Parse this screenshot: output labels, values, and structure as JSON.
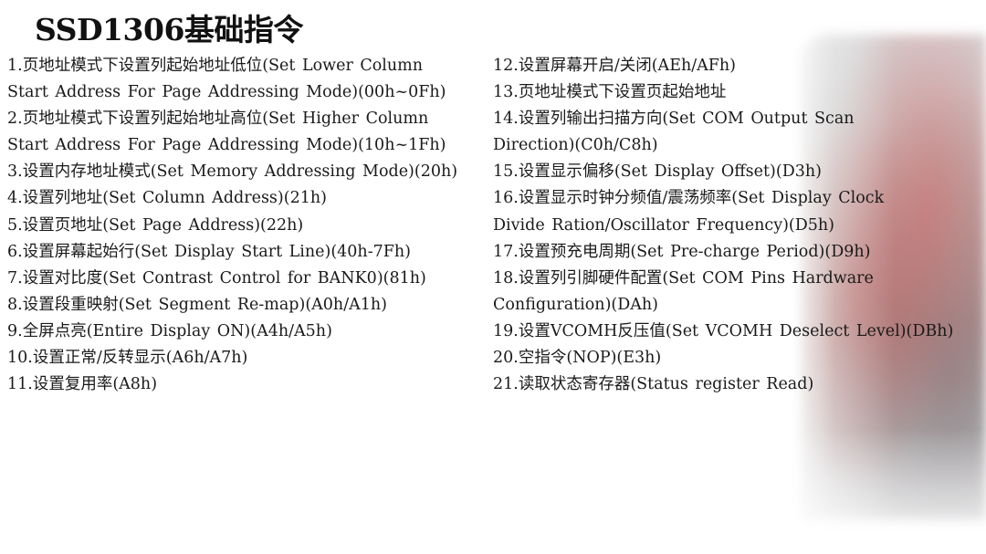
{
  "title": "SSD1306基础指令",
  "left_column": {
    "lines": [
      "1.页地址模式下设置列起始地址低位(Set  Lower Column",
      "Start Address For Page Addressing Mode)(00h~0Fh)",
      "2.页地址模式下设置列起始地址高位(Set  Higher Column",
      "Start Address For Page Addressing Mode)(10h~1Fh)",
      "3.设置内存地址模式(Set Memory Addressing Mode)(20h)",
      "4.设置列地址(Set Column Address)(21h)",
      "5.设置页地址(Set Page Address)(22h)",
      "6.设置屏幕起始行(Set Display Start Line)(40h-7Fh)",
      "7.设置对比度(Set Contrast Control for BANK0)(81h)",
      "8.设置段重映射(Set Segment Re-map)(A0h/A1h)",
      "9.全屏点亮(Entire Display ON)(A4h/A5h)",
      "10.设置正常/反转显示(A6h/A7h)",
      "11.设置复用率(A8h)"
    ]
  },
  "right_column": {
    "lines": [
      "12.设置屏幕开启/关闭(AEh/AFh)",
      "13.页地址模式下设置页起始地址",
      "14.设置列输出扫描方向(Set COM Output Scan",
      "Direction)(C0h/C8h)",
      "15.设置显示偏移(Set Display Offset)(D3h)",
      "16.设置显示时钟分频值/震荡频率(Set Display Clock",
      "Divide Ration/Oscillator Frequency)(D5h)",
      "17.设置预充电周期(Set Pre-charge Period)(D9h)",
      "18.设置列引脚硬件配置(Set COM Pins Hardware",
      "Configuration)(DAh)",
      "19.设置VCOMH反压值(Set VCOMH Deselect Level)(DBh)",
      "20.空指令(NOP)(E3h)",
      "21.读取状态寄存器(Status  register Read)"
    ]
  }
}
